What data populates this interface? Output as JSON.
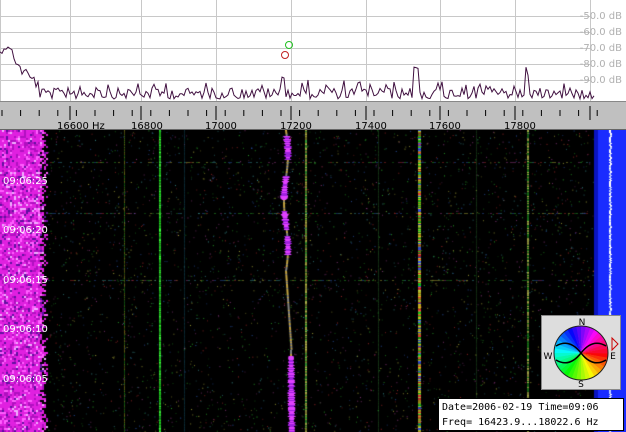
{
  "spectrum": {
    "db_labels": [
      "-50.0 dB",
      "-60.0 dB",
      "-70.0 dB",
      "-80.0 dB",
      "-90.0 dB"
    ],
    "marker_colors": {
      "green": "#20c020",
      "red": "#c02020"
    }
  },
  "freq_axis": {
    "unit_label": "16600 Hz",
    "labels": [
      "16800",
      "17000",
      "17200",
      "17400",
      "17600",
      "17800"
    ]
  },
  "waterfall": {
    "time_labels": [
      "09:06:25",
      "09:06:20",
      "09:06:15",
      "09:06:10",
      "09:06:05"
    ],
    "colors": {
      "background": "#000000",
      "noise_band": "#e020e0",
      "right_band": "#1a2cff"
    }
  },
  "compass": {
    "n": "N",
    "s": "S",
    "e": "E",
    "w": "W"
  },
  "info": {
    "line1": "Date=2006-02-19 Time=09:06",
    "line2": "Freq= 16423.9...18022.6 Hz"
  }
}
